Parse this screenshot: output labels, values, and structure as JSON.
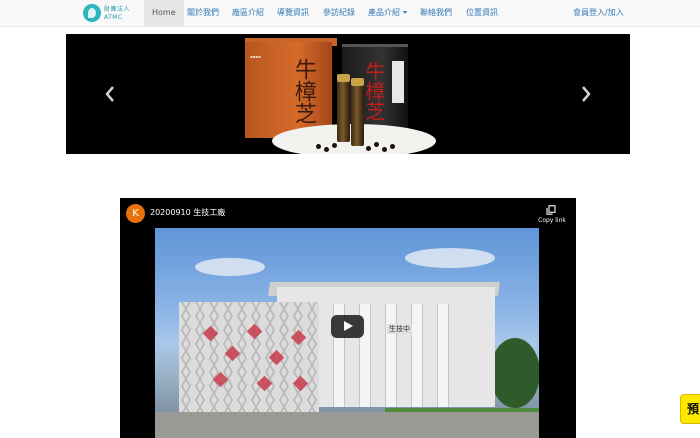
{
  "nav": {
    "logo_line1": "財團法人",
    "logo_line2": "ATMC",
    "home": "Home",
    "items": [
      "關於我們",
      "廠區介紹",
      "導覽資訊",
      "參訪紀錄",
      "產品介紹",
      "聯絡我們",
      "位置資訊"
    ],
    "login": "會員登入/加入"
  },
  "carousel": {
    "box1_brand": "牛樟芝",
    "box2_brand": "牛樟芝",
    "prev_icon": "chevron-left-icon",
    "next_icon": "chevron-right-icon"
  },
  "video": {
    "channel_initial": "K",
    "title": "20200910 生技工廠",
    "copy_label": "Copy link",
    "copy_icon": "copy-icon",
    "play_icon": "play-icon",
    "building_sign": "生技中"
  },
  "float_badge": {
    "label": "預"
  },
  "colors": {
    "link": "#337ab7",
    "navbar_bg": "#f8f8f8",
    "active_bg": "#e7e7e7",
    "logo_teal": "#2fb3bd",
    "badge_yellow": "#ffe800"
  }
}
